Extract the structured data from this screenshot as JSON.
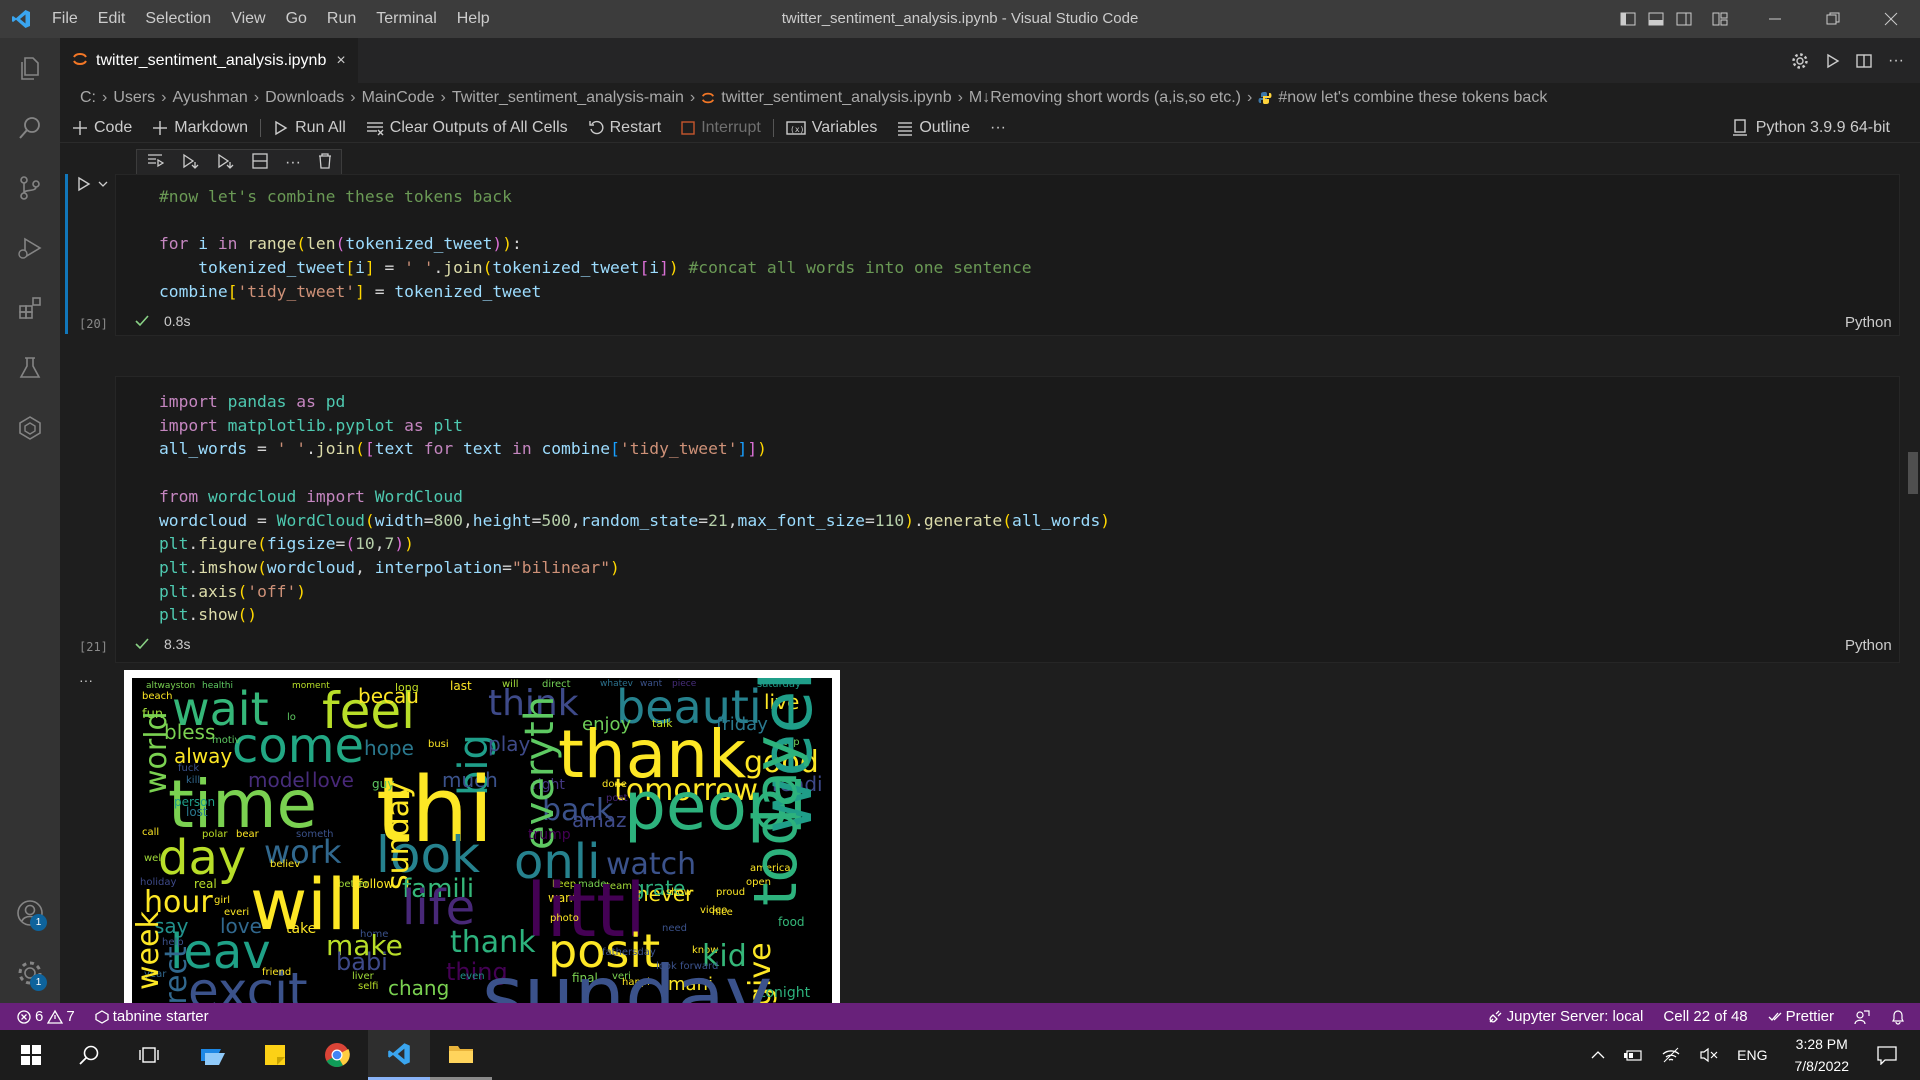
{
  "window": {
    "title": "twitter_sentiment_analysis.ipynb - Visual Studio Code",
    "menu": [
      "File",
      "Edit",
      "Selection",
      "View",
      "Go",
      "Run",
      "Terminal",
      "Help"
    ]
  },
  "tab": {
    "name": "twitter_sentiment_analysis.ipynb",
    "close": "×"
  },
  "breadcrumb": {
    "items": [
      "C:",
      "Users",
      "Ayushman",
      "Downloads",
      "MainCode",
      "Twitter_sentiment_analysis-main",
      "twitter_sentiment_analysis.ipynb",
      "M↓Removing short words (a,is,so etc.)",
      "#now let's combine these tokens back"
    ]
  },
  "toolbar": {
    "code": "Code",
    "markdown": "Markdown",
    "run_all": "Run All",
    "clear_outputs": "Clear Outputs of All Cells",
    "restart": "Restart",
    "interrupt": "Interrupt",
    "variables": "Variables",
    "outline": "Outline",
    "more": "···",
    "kernel": "Python 3.9.9 64-bit"
  },
  "cells": [
    {
      "exec_count": "[20]",
      "status": "0.8s",
      "language": "Python"
    },
    {
      "exec_count": "[21]",
      "status": "8.3s",
      "language": "Python"
    }
  ],
  "output_more": "···",
  "wordcloud_words": [
    "altwayston",
    "healthi",
    "moment",
    "long",
    "last",
    "will",
    "direct",
    "whatev",
    "want",
    "piece",
    "saturday",
    "beach",
    "wait",
    "feel",
    "becau",
    "think",
    "beauti",
    "live",
    "fun",
    "bless",
    "come",
    "enjoy",
    "talk",
    "friday",
    "motiv",
    "alway",
    "hope",
    "busi",
    "big",
    "play",
    "stop",
    "good",
    "world",
    "fuck",
    "model",
    "love",
    "much",
    "thank",
    "tomorrow",
    "readi",
    "kill",
    "time",
    "thi",
    "right",
    "done",
    "peopl",
    "person",
    "lost",
    "guy",
    "back",
    "amaz",
    "post",
    "everyth",
    "trump",
    "weekend",
    "call",
    "polar",
    "bear",
    "someth",
    "day",
    "work",
    "look",
    "onli",
    "watch",
    "america",
    "well",
    "believ",
    "sunday",
    "never",
    "open",
    "holiday",
    "real",
    "famili",
    "keep",
    "made",
    "team",
    "grate",
    "show",
    "proud",
    "follow",
    "better",
    "hour",
    "will",
    "life",
    "want",
    "littl",
    "today",
    "girl",
    "everi",
    "photo",
    "video",
    "nice",
    "say",
    "love",
    "take",
    "home",
    "need",
    "food",
    "leav",
    "make",
    "thank",
    "posit",
    "know",
    "kid",
    "year",
    "help",
    "direct",
    "babi",
    "thing",
    "even",
    "fathersday",
    "look forward",
    "give",
    "week",
    "liver",
    "selfi",
    "chang",
    "final",
    "veri",
    "mani",
    "tonight",
    "excit",
    "friend",
    "happi",
    "sunday",
    "lo"
  ],
  "statusbar": {
    "errors": "6",
    "warnings": "7",
    "tabnine": "tabnine starter",
    "jupyter": "Jupyter Server: local",
    "cell": "Cell 22 of 48",
    "prettier": "Prettier"
  },
  "taskbar": {
    "lang": "ENG",
    "time": "3:28 PM",
    "date": "7/8/2022"
  },
  "badges": {
    "accounts": "1",
    "settings": "1"
  },
  "colors": {
    "statusbar": "#68217a",
    "accent": "#0e639c"
  }
}
